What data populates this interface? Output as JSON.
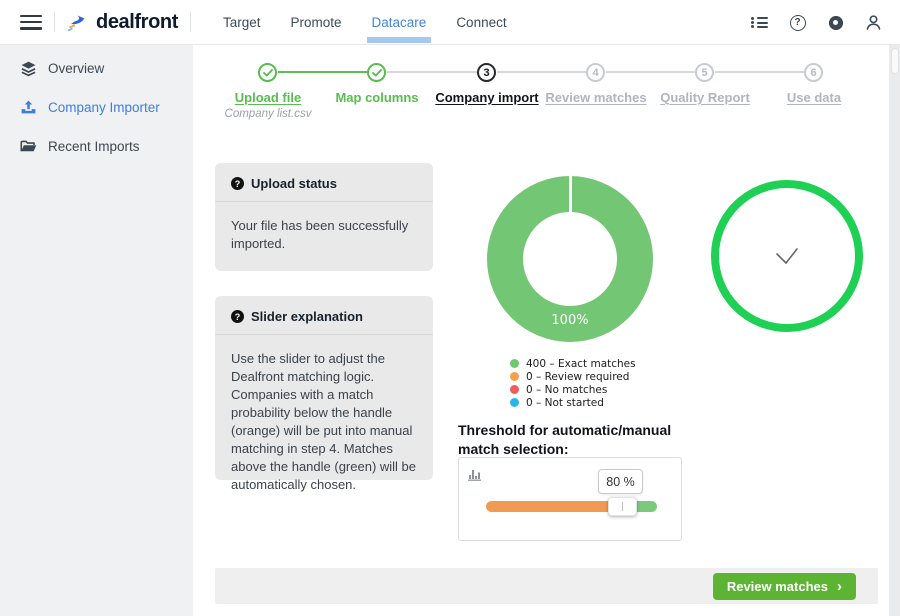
{
  "header": {
    "logo_text": "dealfront",
    "nav": [
      {
        "label": "Target"
      },
      {
        "label": "Promote"
      },
      {
        "label": "Datacare"
      },
      {
        "label": "Connect"
      }
    ],
    "active_tab": "Datacare",
    "accent_blue": "#4285d8",
    "active_underline_color": "#a6c8ee"
  },
  "sidebar": {
    "items": [
      {
        "label": "Overview",
        "icon": "layers-icon"
      },
      {
        "label": "Company Importer",
        "icon": "upload-icon",
        "active": true
      },
      {
        "label": "Recent Imports",
        "icon": "folder-icon"
      }
    ],
    "active_color": "#3f7ddc"
  },
  "stepper": {
    "steps": [
      {
        "label": "Upload file",
        "state": "done",
        "sublabel": "Company list.csv"
      },
      {
        "label": "Map columns",
        "state": "done"
      },
      {
        "label": "Company import",
        "state": "current",
        "number": "3"
      },
      {
        "label": "Review matches",
        "state": "upcoming",
        "number": "4"
      },
      {
        "label": "Quality Report",
        "state": "upcoming",
        "number": "5"
      },
      {
        "label": "Use data",
        "state": "upcoming",
        "number": "6"
      }
    ],
    "done_color": "#56bd4e"
  },
  "panels": {
    "upload_status": {
      "icon_glyph": "?",
      "title": "Upload status",
      "body": "Your file has been successfully imported."
    },
    "slider_explanation": {
      "icon_glyph": "?",
      "title": "Slider explanation",
      "body": "Use the slider to adjust the Dealfront matching logic. Companies with a match probability below the handle (orange) will be put into manual matching in step 4. Matches above the handle (green) will be automatically chosen."
    }
  },
  "chart_data": {
    "type": "pie",
    "labels": [
      "Exact matches",
      "Review required",
      "No matches",
      "Not started"
    ],
    "values": [
      400,
      0,
      0,
      0
    ],
    "colors": [
      "#6fc86f",
      "#f5a04c",
      "#ef5c5c",
      "#29b5ec"
    ],
    "center_label": "100%",
    "legend_position": "bottom",
    "legend": [
      "400 – Exact matches",
      "0 – Review required",
      "0 – No matches",
      "0 – Not started"
    ]
  },
  "success_indicator": {
    "icon": "check-icon",
    "ring_color": "#1ed053"
  },
  "threshold": {
    "title": "Threshold for automatic/manual match selection:",
    "value": "80 %",
    "slider": {
      "percent": 80,
      "below_color": "#f19a54",
      "above_color": "#7cc97c"
    }
  },
  "footer": {
    "review_button_label": "Review matches",
    "chevron": "›",
    "button_color": "#5cb432"
  }
}
